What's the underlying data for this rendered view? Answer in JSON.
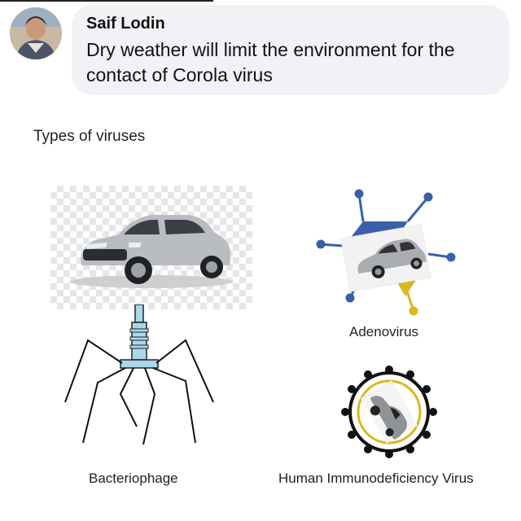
{
  "post": {
    "author": "Saif Lodin",
    "message": "Dry weather will limit the environment for the contact of Corola virus"
  },
  "image": {
    "title": "Types of viruses",
    "labels": {
      "adenovirus": "Adenovirus",
      "bacteriophage": "Bacteriophage",
      "hiv": "Human Immunodeficiency Virus"
    }
  },
  "colors": {
    "bubble": "#f0f2f5",
    "car": "#b9bcc0",
    "phage": "#a9d8ea",
    "adeno_blue": "#3b5fa8",
    "adeno_yellow": "#d8b81c"
  }
}
